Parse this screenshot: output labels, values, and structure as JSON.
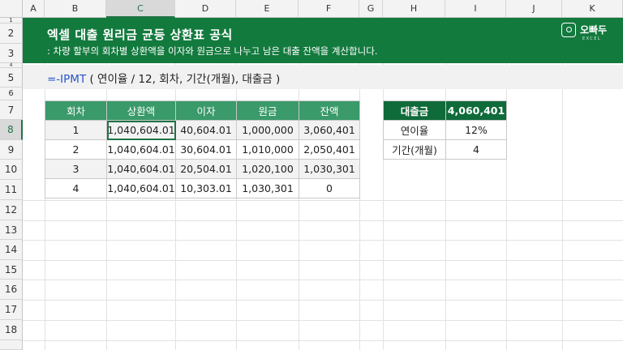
{
  "columns": [
    "A",
    "B",
    "C",
    "D",
    "E",
    "F",
    "G",
    "H",
    "I",
    "J",
    "K"
  ],
  "rows": [
    "1",
    "2",
    "3",
    "4",
    "5",
    "6",
    "7",
    "8",
    "9",
    "10",
    "11",
    "12",
    "13",
    "14",
    "15",
    "16",
    "17",
    "18"
  ],
  "selected_column": "C",
  "selected_row": "8",
  "banner": {
    "title": "엑셀 대출 원리금 균등 상환표 공식",
    "subtitle": ": 차량 할부의 회차별 상환액을 이자와 원금으로 나누고 남은 대출 잔액을 계산합니다.",
    "logo_text": "오빠두",
    "logo_sub": "EXCEL"
  },
  "formula": {
    "fn": "=-IPMT",
    "args": " ( 연이율 / 12, 회차, 기간(개월), 대출금 )"
  },
  "schedule": {
    "headers": [
      "회차",
      "상환액",
      "이자",
      "원금",
      "잔액"
    ],
    "rows": [
      [
        "1",
        "1,040,604.01",
        "40,604.01",
        "1,000,000",
        "3,060,401"
      ],
      [
        "2",
        "1,040,604.01",
        "30,604.01",
        "1,010,000",
        "2,050,401"
      ],
      [
        "3",
        "1,040,604.01",
        "20,504.01",
        "1,020,100",
        "1,030,301"
      ],
      [
        "4",
        "1,040,604.01",
        "10,303.01",
        "1,030,301",
        "0"
      ]
    ]
  },
  "loan": {
    "rows": [
      [
        "대출금",
        "4,060,401"
      ],
      [
        "연이율",
        "12%"
      ],
      [
        "기간(개월)",
        "4"
      ]
    ]
  },
  "colors": {
    "banner": "#137a3e",
    "header_green": "#3a9a6a",
    "dark_green": "#0f6b3a",
    "formula_blue": "#2456c7"
  }
}
